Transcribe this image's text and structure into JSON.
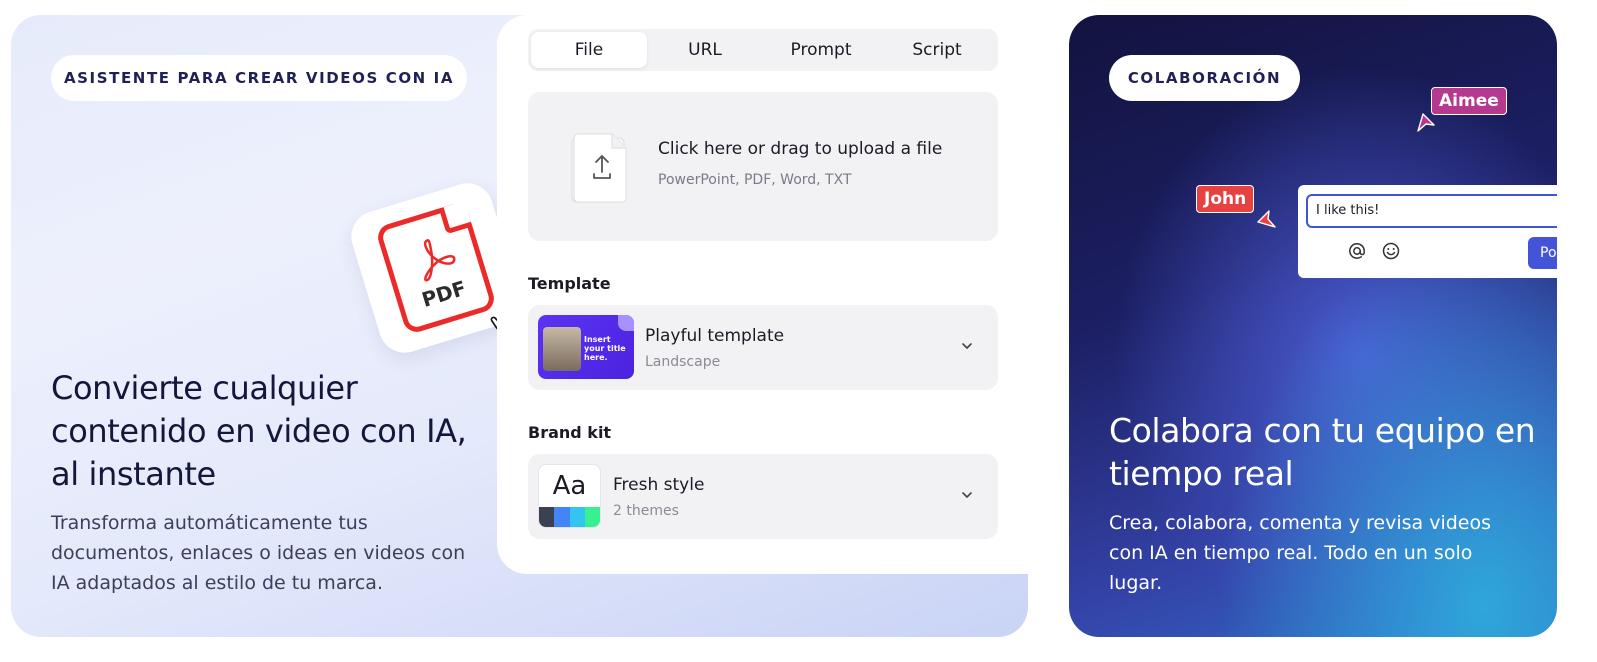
{
  "left_card": {
    "badge": "ASISTENTE PARA CREAR VIDEOS CON IA",
    "title": "Convierte cualquier contenido en video con IA, al instante",
    "description": "Transforma automáticamente tus documentos, enlaces o ideas en videos con IA adaptados al estilo de tu marca.",
    "pdf_label": "PDF"
  },
  "form": {
    "tabs": [
      {
        "label": "File",
        "active": true
      },
      {
        "label": "URL",
        "active": false
      },
      {
        "label": "Prompt",
        "active": false
      },
      {
        "label": "Script",
        "active": false
      }
    ],
    "upload": {
      "title": "Click here or drag to upload a file",
      "subtitle": "PowerPoint, PDF, Word, TXT"
    },
    "template": {
      "label": "Template",
      "name": "Playful template",
      "sub": "Landscape",
      "thumb_text": "Insert your title here."
    },
    "brand_kit": {
      "label": "Brand kit",
      "name": "Fresh style",
      "sub": "2 themes",
      "thumb_text": "Aa",
      "swatches": [
        "#3a4150",
        "#4285f4",
        "#32c5f2",
        "#37f08f"
      ]
    }
  },
  "right_card": {
    "badge": "COLABORACIÓN",
    "cursor_aimee": "Aimee",
    "cursor_john": "John",
    "comment_value": "I like this!",
    "post_label": "Po",
    "title": "Colabora con tu equipo en tiempo real",
    "description": "Crea, colabora, comenta y revisa videos con IA en tiempo real. Todo en un solo lugar."
  },
  "colors": {
    "accent": "#4454d8",
    "pdf_red": "#ec2a2a",
    "aimee": "#b5398f",
    "john": "#e64242"
  },
  "icons": [
    "pdf-icon",
    "grab-hand-icon",
    "upload-icon",
    "chevron-down-icon",
    "at-icon",
    "smiley-icon",
    "cursor-arrow-icon"
  ]
}
